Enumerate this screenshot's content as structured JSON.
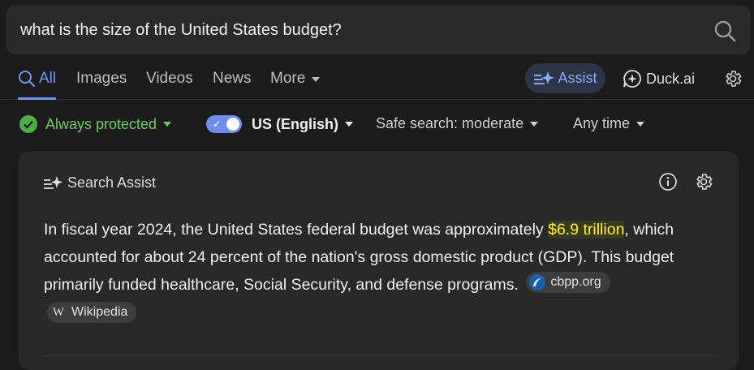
{
  "search": {
    "query": "what is the size of the United States budget?"
  },
  "tabs": {
    "all": "All",
    "images": "Images",
    "videos": "Videos",
    "news": "News",
    "more": "More",
    "assist": "Assist",
    "duck_ai": "Duck.ai"
  },
  "filters": {
    "protection": "Always protected",
    "region": "US (English)",
    "safe_search": "Safe search: moderate",
    "time": "Any time"
  },
  "assist_card": {
    "title": "Search Assist",
    "answer_part1": "In fiscal year 2024, the United States federal budget was approximately ",
    "answer_highlight": "$6.9 trillion",
    "answer_part2": ", which accounted for about 24 percent of the nation's gross domestic product (GDP). This budget primarily funded healthcare, Social Security, and defense programs.",
    "sources": [
      {
        "label": "cbpp.org",
        "icon": "cbpp-icon"
      },
      {
        "label": "Wikipedia",
        "icon": "wikipedia-icon"
      }
    ]
  },
  "colors": {
    "accent": "#7295f6",
    "highlight_text": "#ffee37",
    "protected_green": "#6ecb63"
  }
}
